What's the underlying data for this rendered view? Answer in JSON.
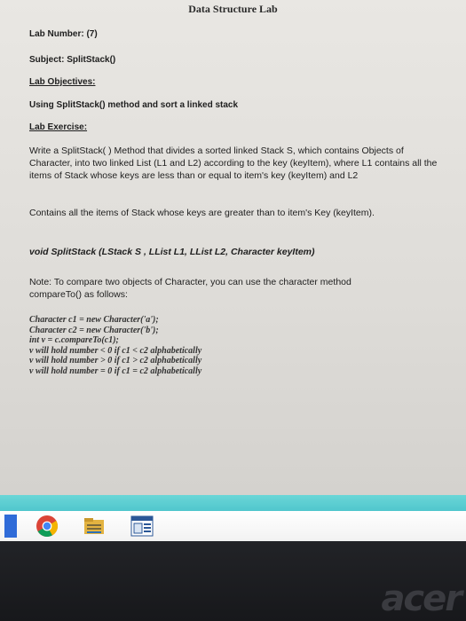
{
  "doc": {
    "title": "Data Structure Lab",
    "lab_number": "Lab Number: (7)",
    "subject": "Subject: SplitStack()",
    "objectives_heading": "Lab Objectives:",
    "objectives_text": "Using SplitStack() method and sort a linked stack",
    "exercise_heading": "Lab Exercise:",
    "exercise_paragraph": "Write a SplitStack( ) Method that divides a sorted linked Stack S, which contains Objects of Character, into two linked List (L1 and L2) according to the key (keyItem), where L1 contains all the items of Stack whose keys are less than or equal to item's key (keyItem) and L2",
    "exercise_paragraph_2": "Contains all the items of Stack whose keys are greater than to item's Key (keyItem).",
    "signature": "void SplitStack (LStack S , LList L1, LList L2, Character keyItem)",
    "note": "Note: To compare two objects of Character, you can use the character method compareTo() as follows:",
    "code": [
      "Character c1 = new Character('a');",
      "Character c2 = new Character('b');",
      "int v = c.compareTo(c1);",
      "v will hold number < 0 if c1 < c2 alphabetically",
      "v will hold number > 0 if c1 > c2 alphabetically",
      "v will hold number = 0 if c1 = c2 alphabetically"
    ]
  },
  "taskbar": {
    "icons": [
      "chrome-icon",
      "file-explorer-icon",
      "word-document-icon"
    ]
  },
  "colors": {
    "taskbar_glow": "#4ec6cc",
    "bezel": "#1c1d21"
  }
}
